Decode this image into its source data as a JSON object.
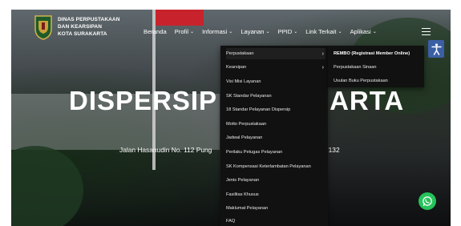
{
  "header": {
    "org_lines": [
      "DINAS PERPUSTAKAAN",
      "DAN KEARSIPAN",
      "KOTA SURAKARTA"
    ],
    "logo_icon": "surakarta-crest-icon",
    "hamburger_icon": "menu-icon"
  },
  "nav": {
    "items": [
      {
        "label": "Beranda",
        "chevron": false
      },
      {
        "label": "Profil",
        "chevron": true
      },
      {
        "label": "Informasi",
        "chevron": true
      },
      {
        "label": "Layanan",
        "chevron": true
      },
      {
        "label": "PPID",
        "chevron": true
      },
      {
        "label": "Link Terkait",
        "chevron": true
      },
      {
        "label": "Aplikasi",
        "chevron": true
      }
    ]
  },
  "hero": {
    "title_left": "DISPERSIP",
    "title_right": "ARTA",
    "address_left": "Jalan Hasanudin No. 112 Pung",
    "address_right": "57132"
  },
  "dropdown": {
    "items": [
      {
        "label": "Perpustakaan",
        "arrow": true
      },
      {
        "label": "Kearsipan",
        "arrow": true
      },
      {
        "label": "Visi Misi Layanan",
        "arrow": false
      },
      {
        "label": "SK Standar Pelayanan",
        "arrow": false
      },
      {
        "label": "18 Standar Pelayanan Dispersip",
        "arrow": false
      },
      {
        "label": "Motto Perpustakaan",
        "arrow": false
      },
      {
        "label": "Jadwal Pelayanan",
        "arrow": false
      },
      {
        "label": "Perilaku Petugas Pelayanan",
        "arrow": false
      },
      {
        "label": "SK Kompensasi Keterlambatan Pelayanan",
        "arrow": false
      },
      {
        "label": "Jenis Pelayanan",
        "arrow": false
      },
      {
        "label": "Fasilitas Khusus",
        "arrow": false
      },
      {
        "label": "Maklumat Pelayanan",
        "arrow": false
      },
      {
        "label": "FAQ",
        "arrow": false
      }
    ]
  },
  "submenu": {
    "items": [
      {
        "label": "REMBO (Registrasi Member Online)"
      },
      {
        "label": "Perpustakaan Sinaan"
      },
      {
        "label": "Usulan Buku Perpustakaan"
      }
    ]
  },
  "floating": {
    "accessibility_icon": "accessibility-icon",
    "whatsapp_icon": "whatsapp-icon"
  },
  "colors": {
    "accessibility_bg": "#3b5fa5",
    "whatsapp_bg": "#25c25a",
    "dropdown_bg": "#111111",
    "flag_red": "#c8232c"
  }
}
